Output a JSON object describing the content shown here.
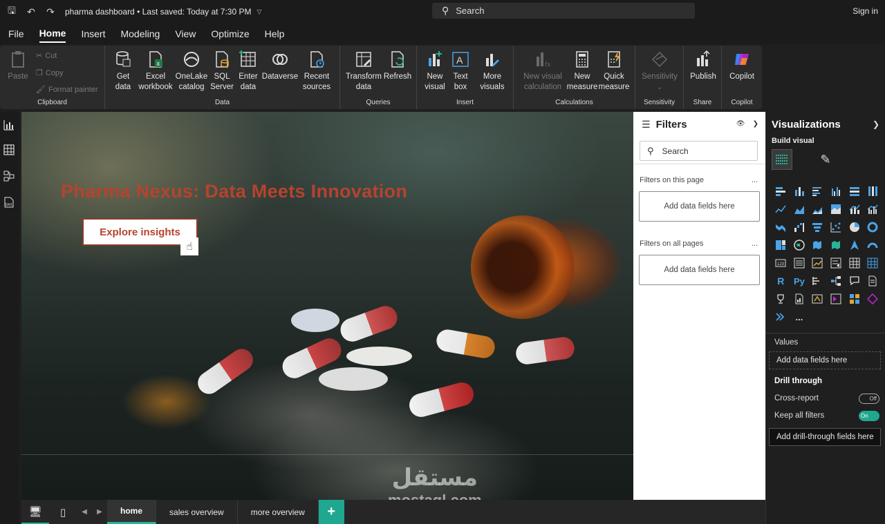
{
  "titlebar": {
    "doc_title": "pharma dashboard • Last saved: Today at 7:30 PM",
    "search_placeholder": "Search",
    "signin": "Sign in"
  },
  "menu": [
    "File",
    "Home",
    "Insert",
    "Modeling",
    "View",
    "Optimize",
    "Help"
  ],
  "menu_active": "Home",
  "ribbon": {
    "clipboard": {
      "paste": "Paste",
      "cut": "Cut",
      "copy": "Copy",
      "format_painter": "Format painter",
      "label": "Clipboard"
    },
    "data": {
      "get_data": "Get data",
      "excel": "Excel workbook",
      "onelake": "OneLake catalog",
      "sql": "SQL Server",
      "enter": "Enter data",
      "dataverse": "Dataverse",
      "recent": "Recent sources",
      "label": "Data"
    },
    "queries": {
      "transform": "Transform data",
      "refresh": "Refresh",
      "label": "Queries"
    },
    "insert": {
      "new_visual": "New visual",
      "text_box": "Text box",
      "more_visuals": "More visuals",
      "label": "Insert"
    },
    "calculations": {
      "new_visual_calc": "New visual calculation",
      "new_measure": "New measure",
      "quick_measure": "Quick measure",
      "label": "Calculations"
    },
    "sensitivity": {
      "btn": "Sensitivity",
      "label": "Sensitivity"
    },
    "share": {
      "publish": "Publish",
      "label": "Share"
    },
    "copilot": {
      "btn": "Copilot",
      "label": "Copilot"
    }
  },
  "canvas": {
    "headline": "Pharma Nexus: Data Meets Innovation",
    "button": "Explore insights",
    "watermark_ar": "مستقل",
    "watermark_en": "mostaql.com"
  },
  "pages": [
    "home",
    "sales overview",
    "more overview"
  ],
  "active_page": "home",
  "filters": {
    "title": "Filters",
    "search": "Search",
    "on_page": "Filters on this page",
    "on_all": "Filters on all pages",
    "add_fields": "Add data fields here",
    "more": "..."
  },
  "viz": {
    "title": "Visualizations",
    "build": "Build visual",
    "values_label": "Values",
    "values_drop": "Add data fields here",
    "drill_label": "Drill through",
    "cross_report": "Cross-report",
    "cross_state": "Off",
    "keep_filters": "Keep all filters",
    "keep_state": "On",
    "drill_drop": "Add drill-through fields here",
    "more": "...",
    "r_label": "R",
    "py_label": "Py"
  },
  "colors": {
    "accent": "#1fa88f",
    "headline": "#b5432e",
    "ribbon_bg": "#2b2b2b",
    "app_bg": "#1f1f1f"
  }
}
